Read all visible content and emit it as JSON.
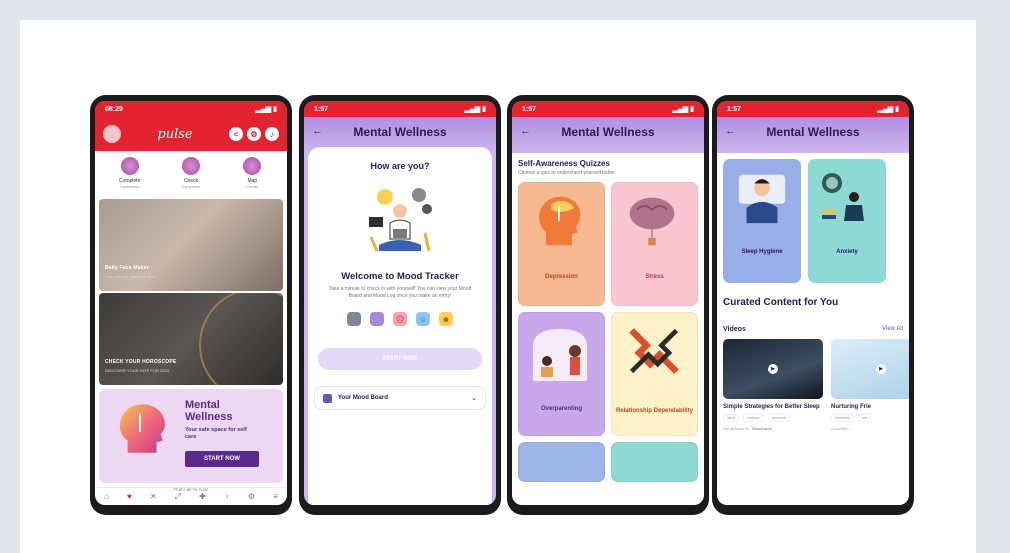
{
  "phone1": {
    "status_time": "08:29",
    "logo": "pulse",
    "quick_actions": [
      {
        "label": "Complete",
        "sub": "Dashboard"
      },
      {
        "label": "Check",
        "sub": "Symptoms"
      },
      {
        "label": "Map",
        "sub": "Center"
      }
    ],
    "banner1": {
      "title": "Baby Face Maker",
      "sub": "How will your baby look like?"
    },
    "banner2": {
      "title": "CHECK YOUR HOROSCOPE",
      "sub": "DISCOVER YOUR FATE FOR 2023"
    },
    "mental": {
      "title_line1": "Mental",
      "title_line2": "Wellness",
      "subtitle": "Your safe space for self care",
      "button": "START NOW"
    },
    "footer": "That's all for now!",
    "nav_icons": [
      "home-icon",
      "heart-icon",
      "crosshair-icon",
      "expand-icon",
      "medical-icon",
      "flask-icon",
      "gear-icon",
      "menu-icon"
    ]
  },
  "phone2": {
    "status_time": "1:57",
    "title": "Mental Wellness",
    "greeting": "How are you?",
    "welcome": "Welcome to Mood Tracker",
    "description": "Take a minute to check in with yourself! You can view your Mood Board and Mood Log once you make an entry!",
    "start_button": "START NOW",
    "mood_board": "Your Mood Board"
  },
  "phone3": {
    "status_time": "1:57",
    "title": "Mental Wellness",
    "section_title": "Self-Awareness Quizzes",
    "section_sub": "Choose a quiz to understand yourself better.",
    "quizzes": [
      {
        "label": "Depression"
      },
      {
        "label": "Stress"
      },
      {
        "label": "Overparenting"
      },
      {
        "label": "Relationship Dependability"
      }
    ]
  },
  "phone4": {
    "status_time": "1:57",
    "title": "Mental Wellness",
    "tiles": [
      {
        "label": "Sleep Hygiene"
      },
      {
        "label": "Anxiety"
      }
    ],
    "curated": "Curated Content for You",
    "videos_label": "Videos",
    "view_all": "View All",
    "videos": [
      {
        "title": "Simple Strategies for Better Sleep",
        "tags": [
          "sleep",
          "selfcare",
          "sleepwell"
        ],
        "excerpt": "We all know h...",
        "read_more": "Read more"
      },
      {
        "title": "Nurturing Frie",
        "tags": [
          "friendship",
          "wel"
        ],
        "excerpt": "Good frie...",
        "read_more": ""
      }
    ]
  }
}
